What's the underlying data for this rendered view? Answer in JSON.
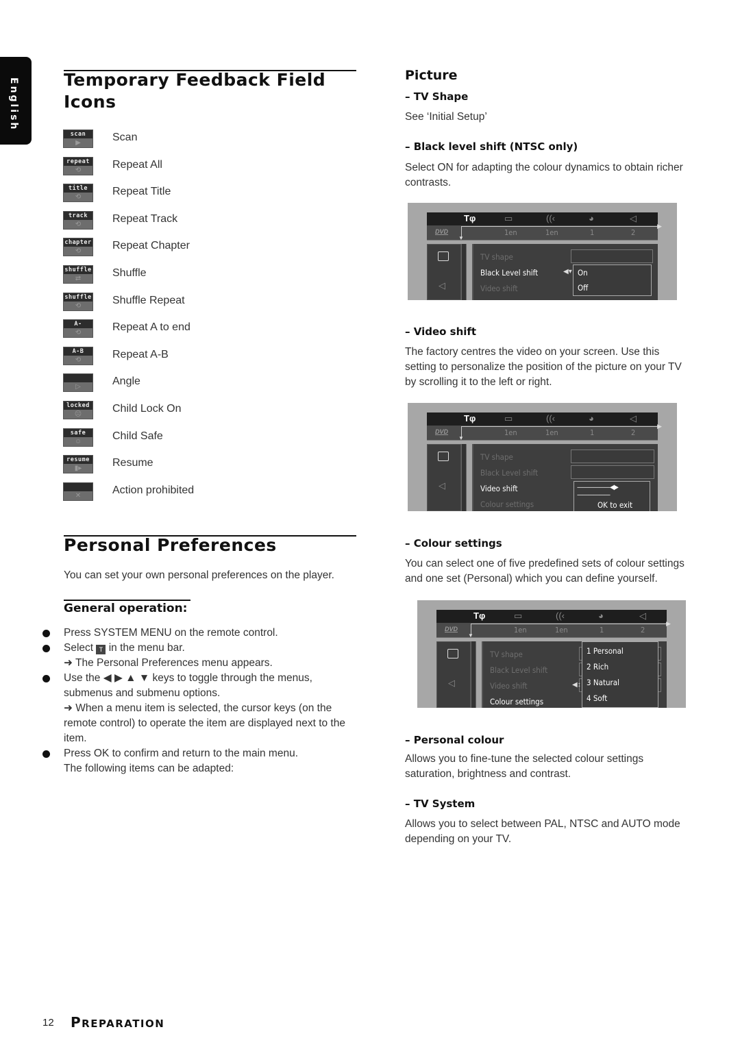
{
  "language_tab": "English",
  "left": {
    "section1_title_line1": "Temporary Feedback Field",
    "section1_title_line2": "Icons",
    "feedback_icons": [
      {
        "tag": "scan",
        "symbol": "▶",
        "label": "Scan",
        "icon": "scan-icon"
      },
      {
        "tag": "repeat",
        "symbol": "⟲",
        "label": "Repeat All",
        "icon": "repeat-all-icon"
      },
      {
        "tag": "title",
        "symbol": "⟲",
        "label": "Repeat Title",
        "icon": "repeat-title-icon"
      },
      {
        "tag": "track",
        "symbol": "⟲",
        "label": "Repeat Track",
        "icon": "repeat-track-icon"
      },
      {
        "tag": "chapter",
        "symbol": "⟲",
        "label": "Repeat Chapter",
        "icon": "repeat-chapter-icon"
      },
      {
        "tag": "shuffle",
        "symbol": "⇄",
        "label": "Shuffle",
        "icon": "shuffle-icon"
      },
      {
        "tag": "shuffle",
        "symbol": "⟲",
        "label": "Shuffle Repeat",
        "icon": "shuffle-repeat-icon"
      },
      {
        "tag": "A-",
        "symbol": "⟲",
        "label": "Repeat A to end",
        "icon": "repeat-a-to-end-icon"
      },
      {
        "tag": "A-B",
        "symbol": "⟲",
        "label": "Repeat A-B",
        "icon": "repeat-a-b-icon"
      },
      {
        "tag": "",
        "symbol": "▷",
        "label": "Angle",
        "icon": "angle-icon"
      },
      {
        "tag": "locked",
        "symbol": "☹",
        "label": "Child Lock On",
        "icon": "child-lock-icon"
      },
      {
        "tag": "safe",
        "symbol": "☺",
        "label": "Child Safe",
        "icon": "child-safe-icon"
      },
      {
        "tag": "resume",
        "symbol": "▮▸",
        "label": "Resume",
        "icon": "resume-icon"
      },
      {
        "tag": "",
        "symbol": "✕",
        "label": "Action prohibited",
        "icon": "action-prohibited-icon"
      }
    ],
    "section2_title": "Personal Preferences",
    "section2_intro": "You can set your own personal preferences on the player.",
    "general_title": "General operation:",
    "bullet1": "Press SYSTEM MENU on the remote control.",
    "bullet2_pre": "Select ",
    "bullet2_icon": "T",
    "bullet2_post": " in the menu bar.",
    "bullet2_result": "➜ The Personal Preferences menu appears.",
    "bullet3_line": "Use the ◀ ▶ ▲ ▼ keys to toggle through the menus, submenus and submenu options.",
    "bullet3_result": "➜ When a menu item is selected, the cursor keys (on the remote control) to operate the item are displayed next to the item.",
    "bullet4": "Press OK to confirm and return to the main menu.",
    "bullet4_cont": "The following items can be adapted:"
  },
  "right": {
    "picture_title": "Picture",
    "tv_shape_title": "–  TV Shape",
    "tv_shape_text": "See ‘Initial Setup’",
    "black_level_title": "–  Black level shift (NTSC only)",
    "black_level_text": "Select ON for adapting the colour dynamics to obtain richer contrasts.",
    "video_shift_title": "–  Video shift",
    "video_shift_text": "The factory centres the video on your screen. Use this setting to personalize the position of the picture on your TV by scrolling it to the left or right.",
    "colour_settings_title": "–  Colour settings",
    "colour_settings_text": "You can select one of five predefined sets of colour settings and one set (Personal) which you can define yourself.",
    "personal_colour_title": "–  Personal colour",
    "personal_colour_text": "Allows you to fine-tune the selected colour settings saturation, brightness and contrast.",
    "tv_system_title": "–  TV System",
    "tv_system_text": "Allows you to select between PAL, NTSC and AUTO mode depending on your TV."
  },
  "osd": {
    "bar_labels": [
      "1en",
      "1en",
      "1",
      "2"
    ],
    "dvd_logo": "DVD",
    "menu_items": [
      "TV shape",
      "Black Level shift",
      "Video shift",
      "Colour settings"
    ],
    "screen1": {
      "selected": "Black Level shift",
      "options": [
        "On",
        "Off"
      ]
    },
    "screen2": {
      "selected": "Video shift",
      "slider": "——————◀▶——————",
      "hint": "OK to exit"
    },
    "screen3": {
      "selected": "Colour settings",
      "options": [
        "1 Personal",
        "2 Rich",
        "3 Natural",
        "4 Soft"
      ]
    }
  },
  "footer": {
    "page_number": "12",
    "section_initial": "P",
    "section_rest": "REPARATION"
  }
}
